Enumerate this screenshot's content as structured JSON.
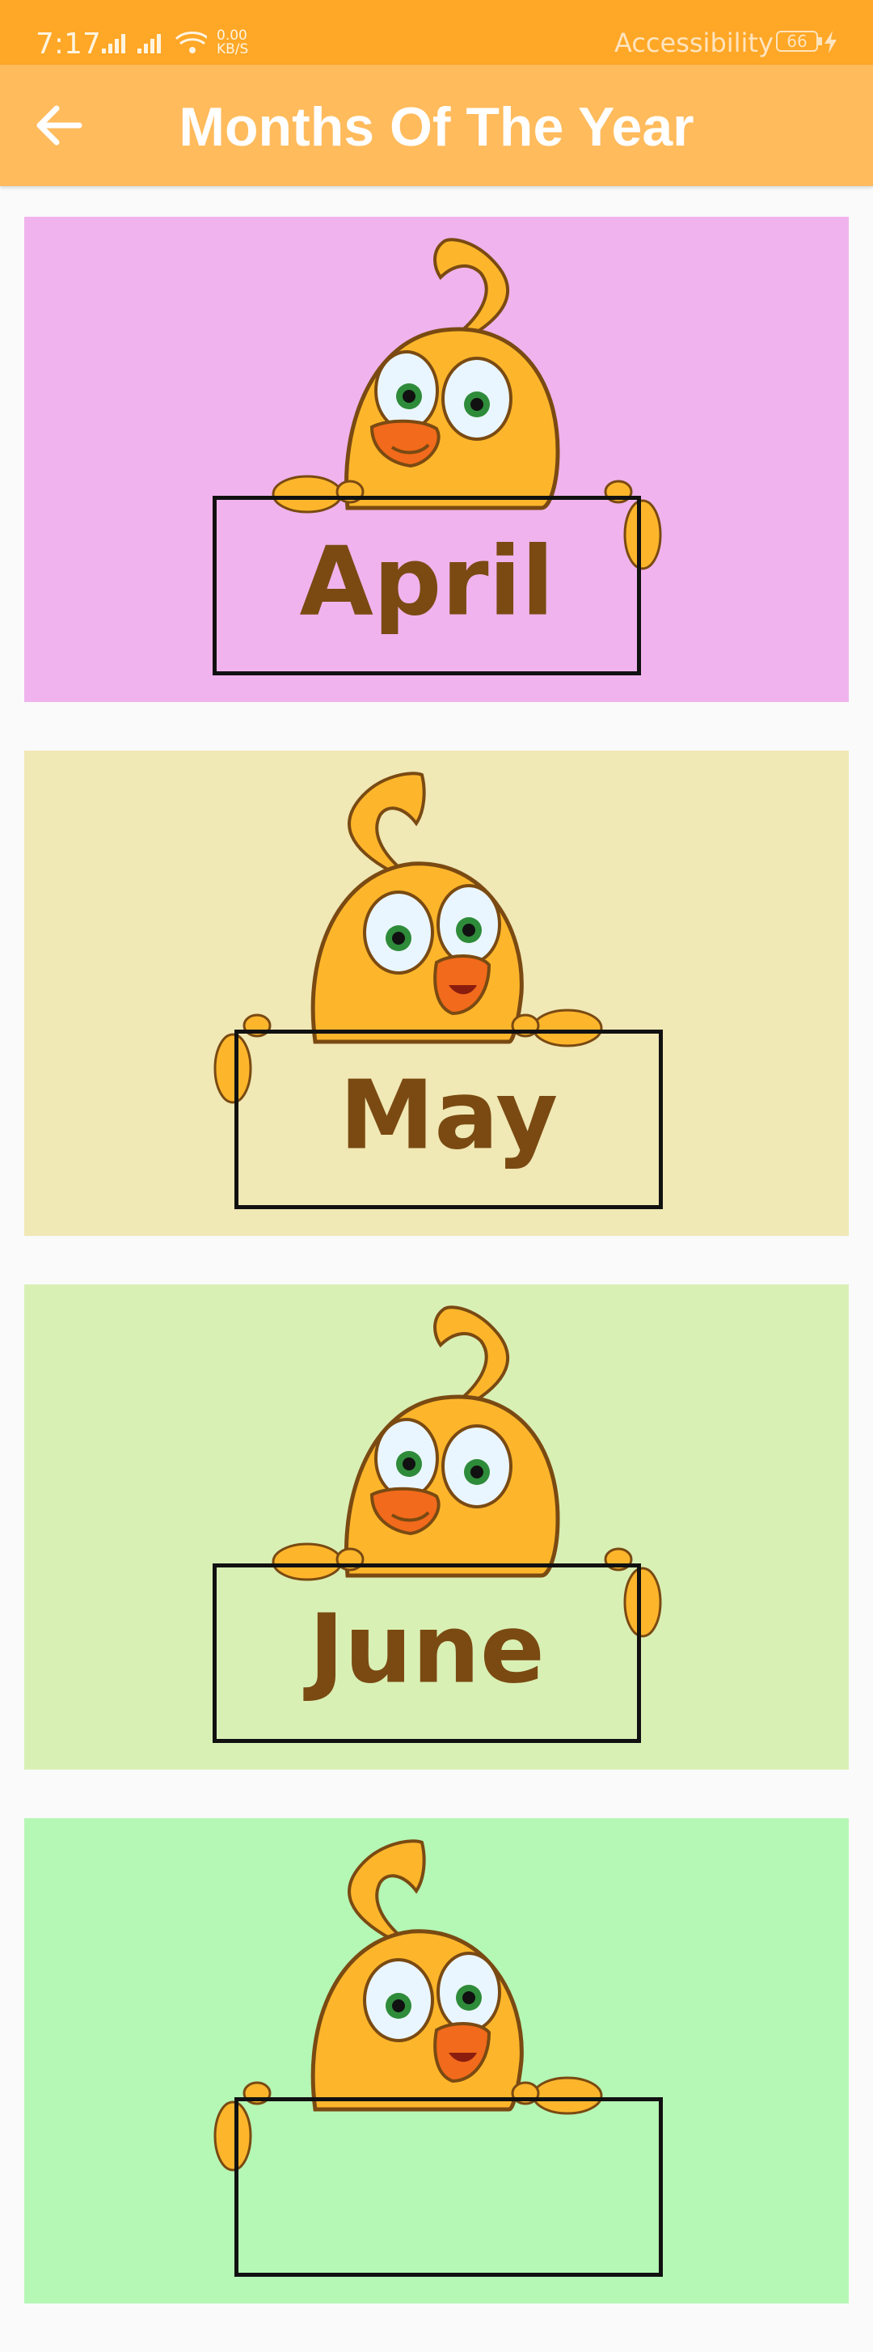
{
  "status_bar": {
    "time": "7:17",
    "net_speed_value": "0.00",
    "net_speed_unit": "KB/S",
    "accessibility_label": "Accessibility",
    "battery_level": "66"
  },
  "app_bar": {
    "title": "Months Of The Year",
    "back_icon": "arrow-left-icon"
  },
  "months": [
    {
      "label": "April",
      "background": "#F0B3ED"
    },
    {
      "label": "May",
      "background": "#F0E8B5"
    },
    {
      "label": "June",
      "background": "#D9F0B5"
    },
    {
      "label": "",
      "background": "#B5F7B5"
    }
  ],
  "colors": {
    "status_bar": "#FFA726",
    "app_bar": "#FFBB5C",
    "label_text": "#7A4A12"
  }
}
